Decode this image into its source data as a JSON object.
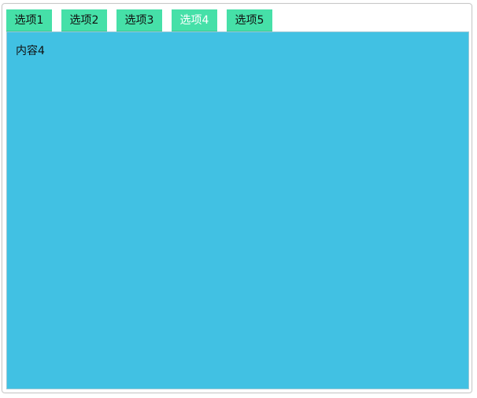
{
  "tabs": [
    {
      "label": "选项1"
    },
    {
      "label": "选项2"
    },
    {
      "label": "选项3"
    },
    {
      "label": "选项4"
    },
    {
      "label": "选项5"
    }
  ],
  "active_tab_index": 3,
  "panel": {
    "content": "内容4"
  },
  "colors": {
    "tab_bg": "#46e0a8",
    "tab_text": "#111111",
    "tab_active_text": "#ffffff",
    "panel_bg": "#41c1e3"
  }
}
